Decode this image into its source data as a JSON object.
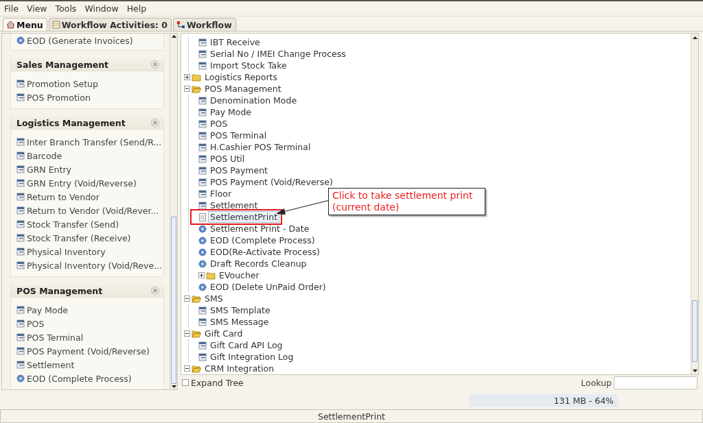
{
  "menu_bar": [
    "File",
    "View",
    "Tools",
    "Window",
    "Help"
  ],
  "tabs": [
    {
      "label": "Menu",
      "kind": "home",
      "selected": true
    },
    {
      "label": "Workflow Activities: 0",
      "kind": "list",
      "selected": false
    },
    {
      "label": "Workflow",
      "kind": "flow",
      "selected": false
    }
  ],
  "sidebar": {
    "sections": [
      {
        "items": [
          {
            "label": "EOD (Generate Invoices)",
            "kind": "process"
          }
        ]
      },
      {
        "title": "Sales Management",
        "items": [
          {
            "label": "Promotion Setup",
            "kind": "form"
          },
          {
            "label": "POS Promotion",
            "kind": "form"
          }
        ]
      },
      {
        "title": "Logistics Management",
        "items": [
          {
            "label": "Inter Branch Transfer (Send/R...",
            "kind": "form"
          },
          {
            "label": "Barcode",
            "kind": "form"
          },
          {
            "label": "GRN Entry",
            "kind": "form"
          },
          {
            "label": "GRN Entry (Void/Reverse)",
            "kind": "form"
          },
          {
            "label": "Return to Vendor",
            "kind": "form"
          },
          {
            "label": "Return to Vendor (Void/Rever...",
            "kind": "form"
          },
          {
            "label": "Stock Transfer (Send)",
            "kind": "form"
          },
          {
            "label": "Stock Transfer (Receive)",
            "kind": "form"
          },
          {
            "label": "Physical Inventory",
            "kind": "form"
          },
          {
            "label": "Physical Inventory (Void/Reve...",
            "kind": "form"
          }
        ]
      },
      {
        "title": "POS Management",
        "items": [
          {
            "label": "Pay Mode",
            "kind": "form"
          },
          {
            "label": "POS",
            "kind": "form"
          },
          {
            "label": "POS Terminal",
            "kind": "form"
          },
          {
            "label": "POS Payment (Void/Reverse)",
            "kind": "form"
          },
          {
            "label": "Settlement",
            "kind": "form"
          },
          {
            "label": "EOD (Complete Process)",
            "kind": "process"
          }
        ]
      }
    ]
  },
  "tree": {
    "nodes": [
      {
        "kind": "hidden_parent",
        "children": [
          {
            "kind": "form",
            "label": "IBT Receive",
            "selected": false
          },
          {
            "kind": "form",
            "label": "Serial No / IMEI Change Process",
            "selected": false
          },
          {
            "kind": "form",
            "label": "Import Stock Take",
            "selected": false
          }
        ]
      },
      {
        "kind": "folder",
        "label": "Logistics Reports",
        "expanded": false
      },
      {
        "kind": "folder",
        "label": "POS Management",
        "expanded": true,
        "children": [
          {
            "kind": "form",
            "label": "Denomination Mode",
            "selected": false
          },
          {
            "kind": "form",
            "label": "Pay Mode",
            "selected": false
          },
          {
            "kind": "form",
            "label": "POS",
            "selected": false
          },
          {
            "kind": "form",
            "label": "POS Terminal",
            "selected": false
          },
          {
            "kind": "form",
            "label": "H.Cashier POS Terminal",
            "selected": false
          },
          {
            "kind": "form",
            "label": "POS Util",
            "selected": false
          },
          {
            "kind": "form",
            "label": "POS Payment",
            "selected": false
          },
          {
            "kind": "form",
            "label": "POS Payment (Void/Reverse)",
            "selected": false
          },
          {
            "kind": "form",
            "label": "Floor",
            "selected": false
          },
          {
            "kind": "form",
            "label": "Settlement",
            "selected": false
          },
          {
            "kind": "report",
            "label": "SettlementPrint",
            "selected": true,
            "highlighted": true
          },
          {
            "kind": "process",
            "label": "Settlement Print - Date",
            "selected": false
          },
          {
            "kind": "process",
            "label": "EOD (Complete Process)",
            "selected": false
          },
          {
            "kind": "process",
            "label": "EOD(Re-Activate Process)",
            "selected": false
          },
          {
            "kind": "process",
            "label": "Draft Records Cleanup",
            "selected": false
          },
          {
            "kind": "folder",
            "label": "EVoucher",
            "expanded": false
          },
          {
            "kind": "process",
            "label": "EOD (Delete UnPaid Order)",
            "selected": false
          }
        ]
      },
      {
        "kind": "folder",
        "label": "SMS",
        "expanded": true,
        "children": [
          {
            "kind": "form",
            "label": "SMS Template",
            "selected": false
          },
          {
            "kind": "form",
            "label": "SMS Message",
            "selected": false
          }
        ]
      },
      {
        "kind": "folder",
        "label": "Gift Card",
        "expanded": true,
        "children": [
          {
            "kind": "form",
            "label": "Gift Card API Log",
            "selected": false
          },
          {
            "kind": "form",
            "label": "Gift Integration Log",
            "selected": false
          }
        ]
      },
      {
        "kind": "folder",
        "label": "CRM Integration",
        "expanded": true
      }
    ]
  },
  "callout": {
    "text": "Click to take settlement print (current date)"
  },
  "expand_tree": {
    "label": "Expand Tree",
    "checked": false
  },
  "lookup": {
    "label": "Lookup"
  },
  "memory": {
    "text": "131 MB - 64%"
  },
  "status_bar": {
    "text": "SettlementPrint"
  }
}
